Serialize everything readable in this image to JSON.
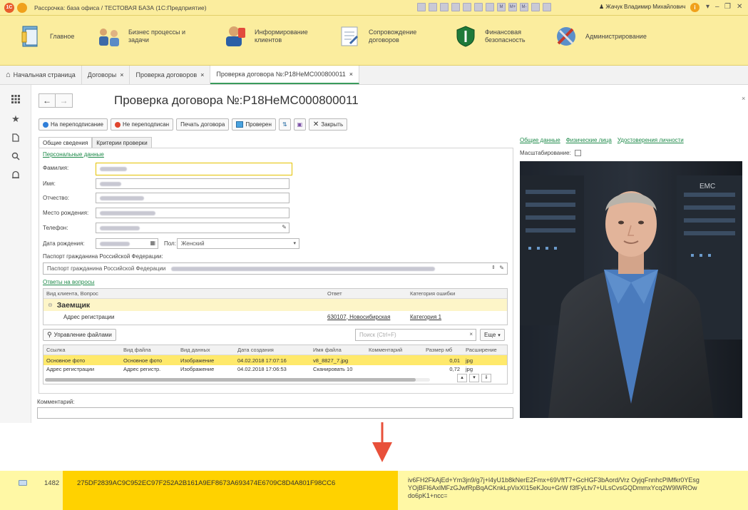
{
  "window": {
    "title": "Рассрочка: база офиса / ТЕСТОВАЯ БАЗА  (1С:Предприятие)",
    "user": "Жачук Владимир Михайлович"
  },
  "sections": [
    {
      "label": "Главное",
      "icon": "home-icon"
    },
    {
      "label": "Бизнес процессы и задачи",
      "icon": "business-process-icon"
    },
    {
      "label": "Информирование клиентов",
      "icon": "inform-clients-icon"
    },
    {
      "label": "Сопровождение договоров",
      "icon": "contract-support-icon"
    },
    {
      "label": "Финансовая безопасность",
      "icon": "shield-icon"
    },
    {
      "label": "Администрирование",
      "icon": "admin-tools-icon"
    }
  ],
  "tabs": [
    {
      "label": "Начальная страница",
      "closable": false
    },
    {
      "label": "Договоры",
      "closable": true
    },
    {
      "label": "Проверка договоров",
      "closable": true
    },
    {
      "label": "Проверка договора №:P18HeMC000800011",
      "closable": true,
      "active": true
    }
  ],
  "form": {
    "title": "Проверка договора №:P18HeMC000800011",
    "close_glyph": "×",
    "buttons": {
      "resign": "На переподписание",
      "not_resign": "Не переподписан",
      "print": "Печать договора",
      "checked": "Проверен",
      "close": "Закрыть"
    },
    "inner_tabs": [
      "Общие сведения",
      "Критерии проверки"
    ],
    "personal_link": "Персональные данные",
    "fields": {
      "surname": "Фамилия:",
      "name": "Имя:",
      "patronymic": "Отчество:",
      "birthplace": "Место рождения:",
      "phone": "Телефон:",
      "birthdate": "Дата рождения:",
      "gender_label": "Пол:",
      "gender_value": "Женский",
      "passport_label": "Паспорт гражданина Российской Федерации:",
      "passport_value": "Паспорт гражданина Российской Федерации"
    },
    "answers_link": "Ответы на вопросы",
    "answers": {
      "columns": [
        "Вид клиента, Вопрос",
        "Ответ",
        "Категория ошибки"
      ],
      "group": "Заемщик",
      "row_question": "Адрес регистрации",
      "row_answer": "630107, Новосибирская",
      "row_category": "Категория 1"
    },
    "files": {
      "manage_button": "Управление файлами",
      "search_placeholder": "Поиск (Ctrl+F)",
      "more_button": "Еще",
      "columns": [
        "Ссылка",
        "Вид файла",
        "Вид данных",
        "Дата создания",
        "Имя файла",
        "Комментарий",
        "Размер мб",
        "Расширение"
      ],
      "rows": [
        {
          "link": "Основное фото",
          "kind": "Основное фото",
          "data": "Изображение",
          "date": "04.02.2018 17:07:16",
          "name": "v8_8827_7.jpg",
          "comment": "",
          "size": "0,01",
          "ext": "jpg"
        },
        {
          "link": "Адрес регистрации",
          "kind": "Адрес регистр.",
          "data": "Изображение",
          "date": "04.02.2018 17:06:53",
          "name": "Сканировать 10",
          "comment": "",
          "size": "0,72",
          "ext": "jpg"
        }
      ]
    },
    "comment_label": "Комментарий:",
    "right_links": [
      "Общие данные",
      "Физические лица",
      "Удостоверения личности"
    ],
    "scale_label": "Масштабирование:",
    "photo_brand": "EMC"
  },
  "result": {
    "id": "1482",
    "hash": "275DF2839AC9C952EC97F252A2B161A9EF8673A693474E6709C8D4A801F98CC6",
    "base64": "iv6FH2FkAjEd+Ym3jn9/g7j+l4yU1b8kNerE2Fmx+69VftT7+GcHGF3bAord/Vrz OyjqFnnhcPlMfkr0YEsgYOjBFl6AxlMFzGJwfRpBqACKnkLpVixXI15eKJou+GrW f3fFyLtv7+ULsCvsGQDmmxYcq2W9lWROwdo6pK1+ncc="
  },
  "colors": {
    "accent_yellow": "#fbed9e",
    "key_yellow": "#ffd200",
    "link_green": "#1e8a4a",
    "arrow_red": "#e8503a"
  }
}
